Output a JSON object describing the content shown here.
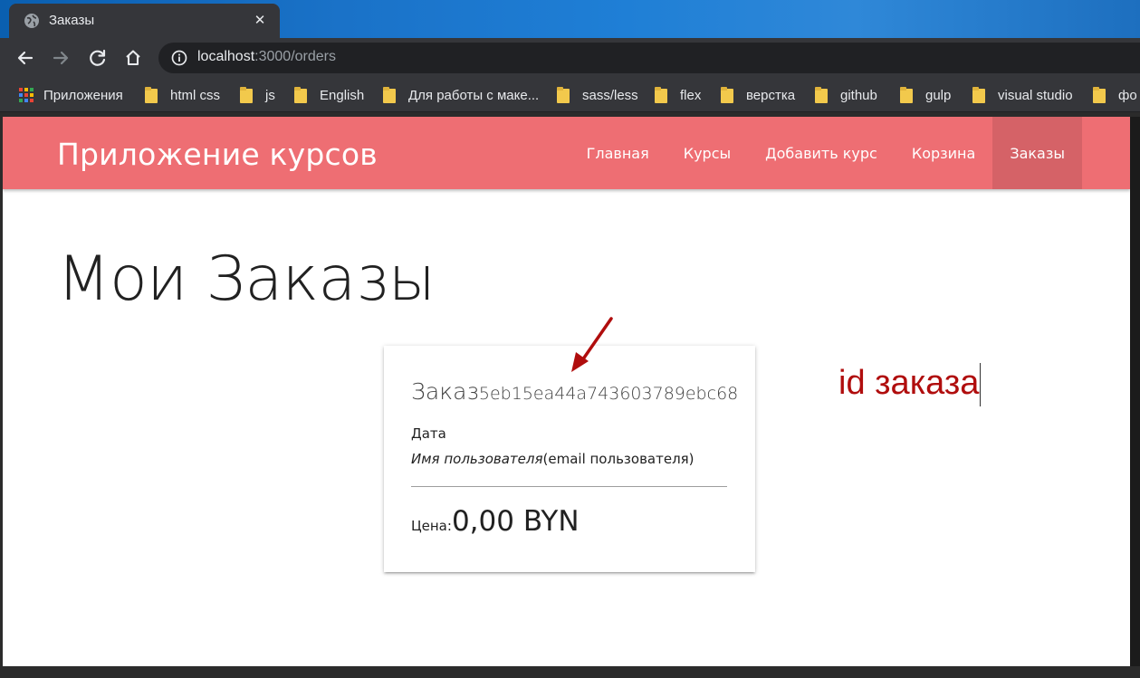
{
  "browser": {
    "tab": {
      "title": "Заказы",
      "close_glyph": "✕"
    },
    "address": {
      "host": "localhost",
      "rest": ":3000/orders"
    },
    "bookmarks": [
      {
        "label": "Приложения",
        "icon": "apps-grid-icon"
      },
      {
        "label": "html css",
        "icon": "folder-icon"
      },
      {
        "label": "js",
        "icon": "folder-icon"
      },
      {
        "label": "English",
        "icon": "folder-icon"
      },
      {
        "label": "Для работы с маке...",
        "icon": "folder-icon"
      },
      {
        "label": "sass/less",
        "icon": "folder-icon"
      },
      {
        "label": "flex",
        "icon": "folder-icon"
      },
      {
        "label": "верстка",
        "icon": "folder-icon"
      },
      {
        "label": "github",
        "icon": "folder-icon"
      },
      {
        "label": "gulp",
        "icon": "folder-icon"
      },
      {
        "label": "visual studio",
        "icon": "folder-icon"
      },
      {
        "label": "фо",
        "icon": "folder-icon"
      }
    ]
  },
  "site": {
    "brand": "Приложение курсов",
    "nav": [
      {
        "label": "Главная",
        "active": false
      },
      {
        "label": "Курсы",
        "active": false
      },
      {
        "label": "Добавить курс",
        "active": false
      },
      {
        "label": "Корзина",
        "active": false
      },
      {
        "label": "Заказы",
        "active": true
      }
    ],
    "accent_color": "#ee6e73"
  },
  "page": {
    "title": "Мои Заказы",
    "order": {
      "label": "Заказ",
      "id": "5eb15ea44a743603789ebc68",
      "date_label": "Дата",
      "user_name": "Имя пользователя",
      "user_email": "(email пользователя)",
      "price_label": "Цена:",
      "price_value": "0,00 BYN"
    },
    "annotation": {
      "text": "id заказа",
      "color": "#b00d0d"
    }
  }
}
